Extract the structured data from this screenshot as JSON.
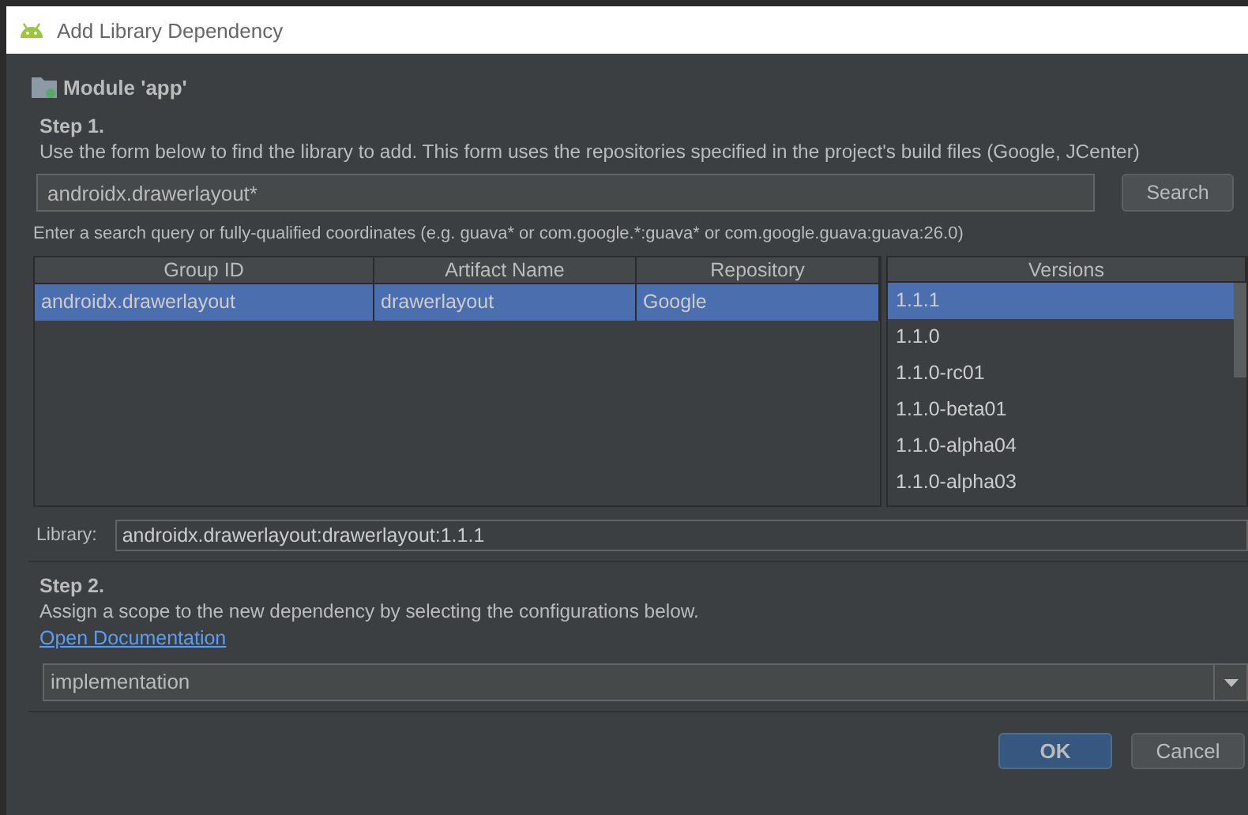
{
  "window": {
    "title": "Add Library Dependency"
  },
  "module": {
    "label": "Module 'app'"
  },
  "step1": {
    "title": "Step 1.",
    "description": "Use the form below to find the library to add. This form uses the repositories specified in the project's build files (Google, JCenter)"
  },
  "search": {
    "value": "androidx.drawerlayout*",
    "button": "Search",
    "hint": "Enter a search query or fully-qualified coordinates (e.g. guava* or com.google.*:guava* or com.google.guava:guava:26.0)"
  },
  "table": {
    "columns": [
      "Group ID",
      "Artifact Name",
      "Repository"
    ],
    "rows": [
      {
        "cells": [
          "androidx.drawerlayout",
          "drawerlayout",
          "Google"
        ],
        "selected": true
      }
    ]
  },
  "versions": {
    "column": "Versions",
    "items": [
      {
        "label": "1.1.1",
        "selected": true
      },
      {
        "label": "1.1.0",
        "selected": false
      },
      {
        "label": "1.1.0-rc01",
        "selected": false
      },
      {
        "label": "1.1.0-beta01",
        "selected": false
      },
      {
        "label": "1.1.0-alpha04",
        "selected": false
      },
      {
        "label": "1.1.0-alpha03",
        "selected": false
      }
    ]
  },
  "library": {
    "label": "Library:",
    "value": "androidx.drawerlayout:drawerlayout:1.1.1"
  },
  "step2": {
    "title": "Step 2.",
    "description": "Assign a scope to the new dependency by selecting the configurations below.",
    "link": "Open Documentation"
  },
  "scope": {
    "value": "implementation"
  },
  "buttons": [
    {
      "label": "OK",
      "kind": "primary"
    },
    {
      "label": "Cancel",
      "kind": "secondary"
    }
  ]
}
